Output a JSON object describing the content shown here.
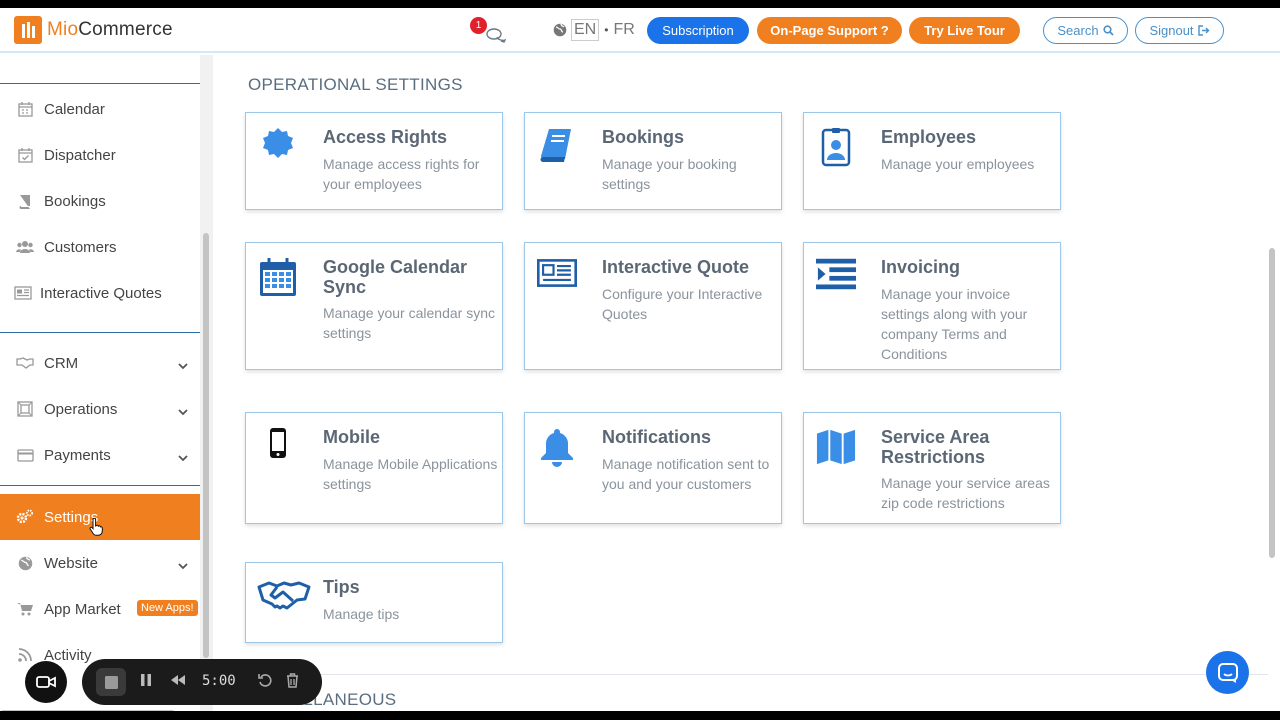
{
  "header": {
    "logo_prefix": "Mio",
    "logo_suffix": "Commerce",
    "notification_count": "1",
    "lang_en": "EN",
    "lang_sep": "•",
    "lang_fr": "FR",
    "subscription_label": "Subscription",
    "support_label": "On-Page Support ?",
    "tour_label": "Try Live Tour",
    "search_label": "Search",
    "signout_label": "Signout"
  },
  "sidebar": {
    "items": [
      {
        "label": "Calendar",
        "icon": "calendar-icon"
      },
      {
        "label": "Dispatcher",
        "icon": "calendar-check-icon"
      },
      {
        "label": "Bookings",
        "icon": "book-icon"
      },
      {
        "label": "Customers",
        "icon": "users-icon"
      },
      {
        "label": "Interactive Quotes",
        "icon": "newspaper-icon"
      },
      {
        "label": "CRM",
        "icon": "handshake-icon"
      },
      {
        "label": "Operations",
        "icon": "operations-icon"
      },
      {
        "label": "Payments",
        "icon": "credit-card-icon"
      },
      {
        "label": "Settings",
        "icon": "gears-icon"
      },
      {
        "label": "Website",
        "icon": "globe-icon"
      },
      {
        "label": "App Market",
        "icon": "cart-icon"
      },
      {
        "label": "Activity",
        "icon": "rss-icon"
      }
    ],
    "new_apps_badge": "New Apps!"
  },
  "main": {
    "section_title": "OPERATIONAL SETTINGS",
    "section2_title": "MISCELLANEOUS",
    "cards": [
      {
        "title": "Access Rights",
        "desc": "Manage access rights for your employees",
        "icon": "badge-icon"
      },
      {
        "title": "Bookings",
        "desc": "Manage your booking settings",
        "icon": "book-icon"
      },
      {
        "title": "Employees",
        "desc": "Manage your employees",
        "icon": "id-badge-icon"
      },
      {
        "title": "Google Calendar Sync",
        "desc": "Manage your calendar sync settings",
        "icon": "calendar-icon"
      },
      {
        "title": "Interactive Quote",
        "desc": "Configure your Interactive Quotes",
        "icon": "newspaper-icon"
      },
      {
        "title": "Invoicing",
        "desc": "Manage your invoice settings along with your company Terms and Conditions",
        "icon": "indent-icon"
      },
      {
        "title": "Mobile",
        "desc": "Manage Mobile Applications settings",
        "icon": "mobile-icon"
      },
      {
        "title": "Notifications",
        "desc": "Manage notification sent to you and your customers",
        "icon": "bell-icon"
      },
      {
        "title": "Service Area Restrictions",
        "desc": "Manage your service areas zip code restrictions",
        "icon": "map-icon"
      },
      {
        "title": "Tips",
        "desc": "Manage tips",
        "icon": "handshake-icon"
      }
    ]
  },
  "recorder": {
    "time": "5:00"
  },
  "colors": {
    "accent": "#f0801f",
    "primary": "#1a73e8",
    "icon_blue": "#1f5fa8"
  }
}
